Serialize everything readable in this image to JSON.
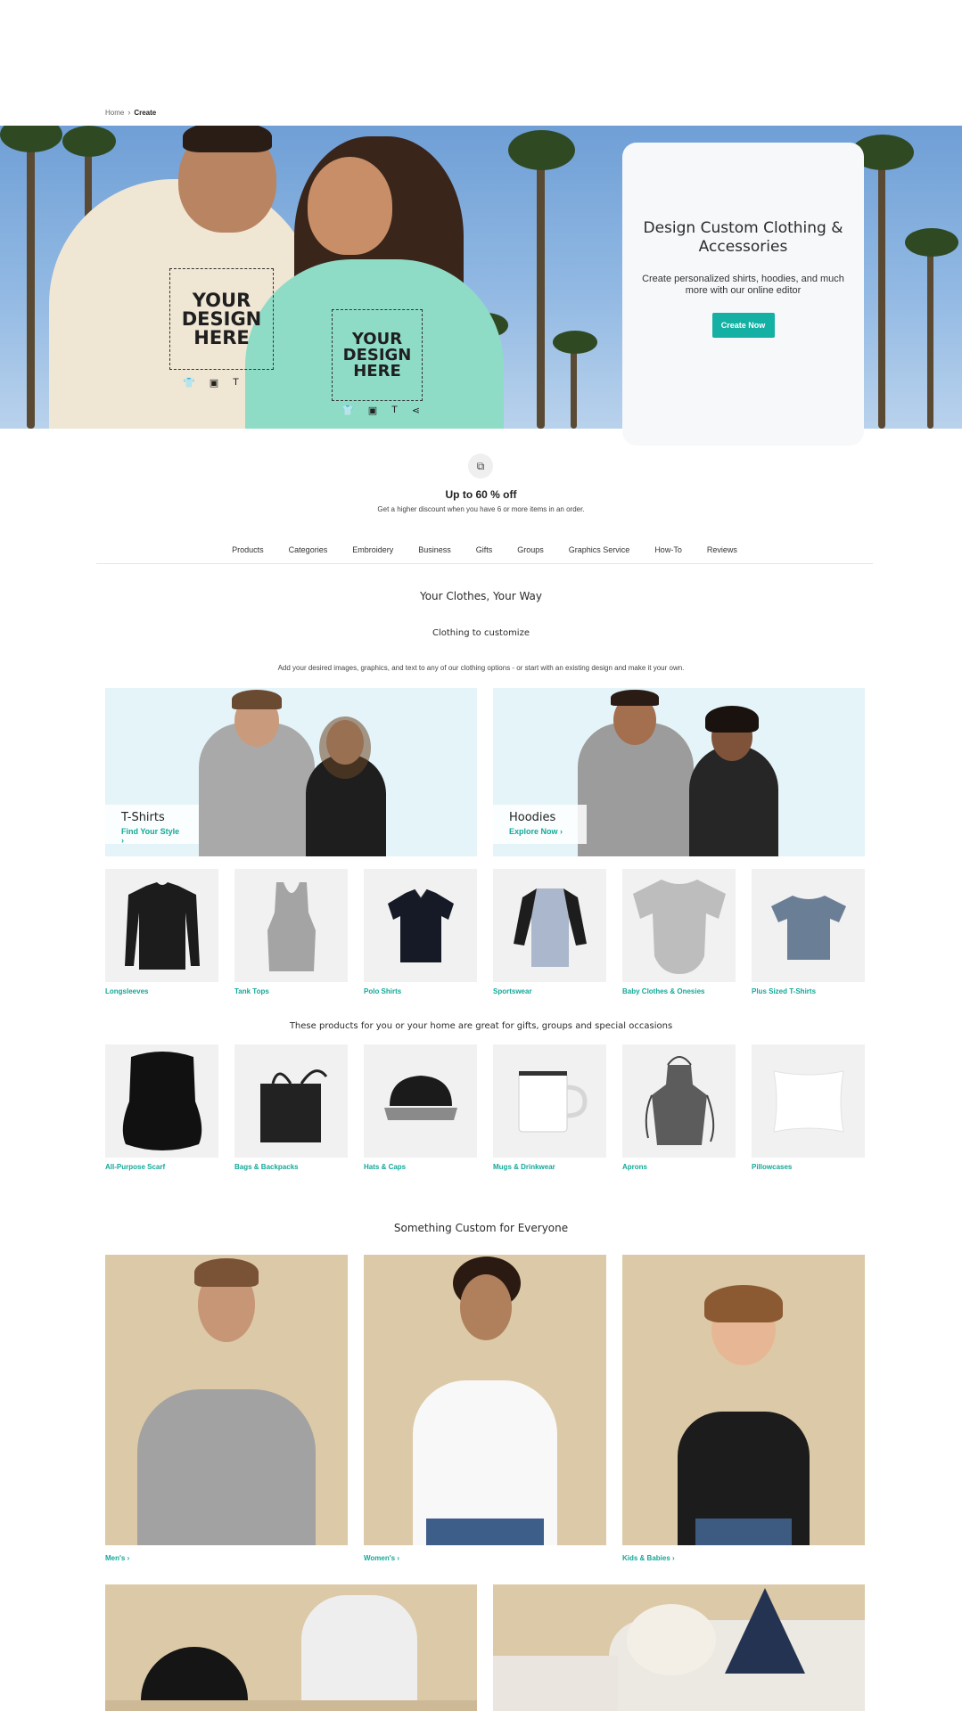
{
  "breadcrumb": {
    "home": "Home",
    "current": "Create"
  },
  "hero": {
    "design_text": "YOUR DESIGN HERE",
    "card_title": "Design Custom Clothing & Accessories",
    "card_subtitle": "Create personalized shirts, hoodies, and much more with our online editor",
    "cta_label": "Create Now"
  },
  "discount": {
    "title": "Up to 60 % off",
    "subtitle": "Get a higher discount when you have 6 or more items in an order."
  },
  "nav": {
    "items": [
      "Products",
      "Categories",
      "Embroidery",
      "Business",
      "Gifts",
      "Groups",
      "Graphics Service",
      "How-To",
      "Reviews"
    ]
  },
  "clothes_section": {
    "title": "Your Clothes, Your Way",
    "subtitle": "Clothing to customize",
    "description": "Add your desired images, graphics, and text to any of our clothing options - or start with an existing design and make it your own."
  },
  "promos": [
    {
      "name": "T-Shirts",
      "link": "Find Your Style"
    },
    {
      "name": "Hoodies",
      "link": "Explore Now"
    }
  ],
  "clothing_tiles": [
    "Longsleeves",
    "Tank Tops",
    "Polo Shirts",
    "Sportswear",
    "Baby Clothes & Onesies",
    "Plus Sized T-Shirts"
  ],
  "gifts_section": {
    "title": "These products for you or your home are great for gifts, groups and special occasions"
  },
  "gift_tiles": [
    "All-Purpose Scarf",
    "Bags & Backpacks",
    "Hats & Caps",
    "Mugs & Drinkwear",
    "Aprons",
    "Pillowcases"
  ],
  "everyone_section": {
    "title": "Something Custom for Everyone",
    "items": [
      "Men's",
      "Women's",
      "Kids & Babies"
    ]
  },
  "colors": {
    "accent": "#13b0a3",
    "link": "#13a89a",
    "tile_bg": "#f1f1f1",
    "promo_bg": "#e5f4f8",
    "photo_bg": "#dcc9a7"
  }
}
